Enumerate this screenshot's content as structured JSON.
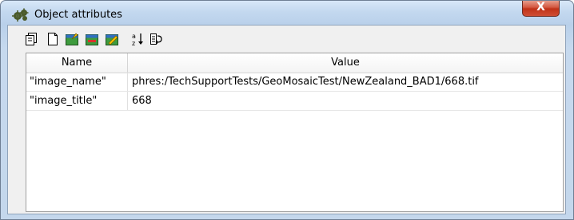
{
  "window": {
    "title": "Object attributes",
    "close_glyph": "X",
    "icon": "gear-cluster-icon"
  },
  "toolbar": {
    "buttons": [
      {
        "name": "copy-icon"
      },
      {
        "name": "new-page-icon"
      },
      {
        "name": "add-attribute-icon"
      },
      {
        "name": "remove-attribute-icon"
      },
      {
        "name": "edit-attribute-icon"
      },
      {
        "name": "sort-az-icon"
      },
      {
        "name": "import-icon"
      }
    ]
  },
  "table": {
    "columns": [
      "Name",
      "Value"
    ],
    "rows": [
      {
        "name": "\"image_name\"",
        "value": "phres:/TechSupportTests/GeoMosaicTest/NewZealand_BAD1/668.tif"
      },
      {
        "name": "\"image_title\"",
        "value": "668"
      }
    ]
  },
  "colors": {
    "title_bar": "#c3d8ef",
    "close_button": "#c03218",
    "client_bg": "#f0f0f0",
    "grid_bg": "#ffffff"
  }
}
